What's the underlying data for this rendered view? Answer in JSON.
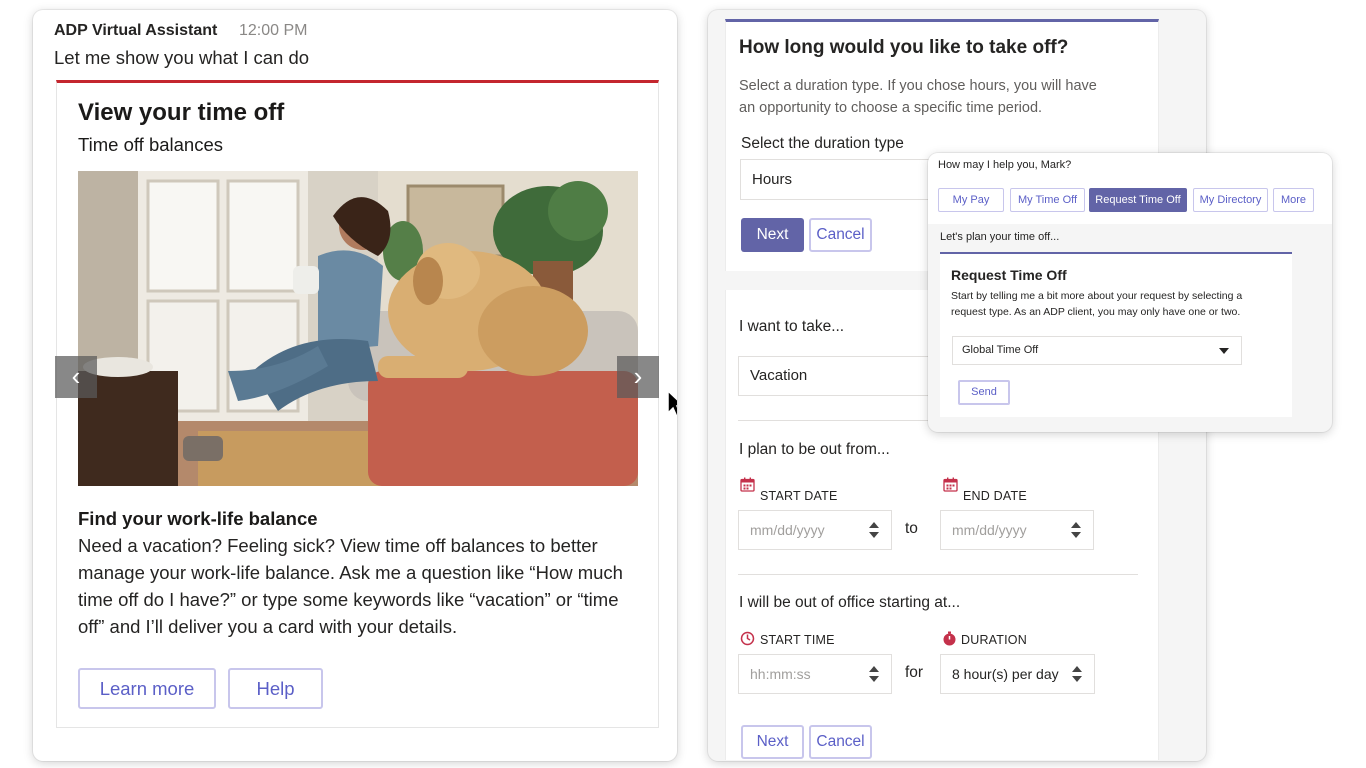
{
  "chat": {
    "sender": "ADP Virtual Assistant",
    "time": "12:00 PM",
    "intro": "Let me show you what I can do"
  },
  "card": {
    "title": "View your time off",
    "subtitle": "Time off balances",
    "heading": "Find your work-life balance",
    "body": "Need a vacation? Feeling sick? View time off balances to better manage your work-life balance. Ask me a question like “How much time off do I have?” or type some keywords like “vacation” or “time off” and I’ll deliver you a card with your details.",
    "learn_more": "Learn more",
    "help": "Help",
    "prev_arrow": "‹",
    "next_arrow": "›"
  },
  "duration_form": {
    "title": "How long would you like to take off?",
    "description": "Select a duration type. If you chose hours, you will have an opportunity to choose a specific time period.",
    "select_label": "Select the duration type",
    "selected": "Hours",
    "next": "Next",
    "cancel": "Cancel"
  },
  "details_form": {
    "take_label": "I want to take...",
    "take_value": "Vacation",
    "out_from_label": "I plan to be out from...",
    "start_date_label": "START DATE",
    "end_date_label": "END DATE",
    "date_placeholder": "mm/dd/yyyy",
    "to": "to",
    "office_label": "I will be out of office starting at...",
    "start_time_label": "START TIME",
    "duration_label": "DURATION",
    "time_placeholder": "hh:mm:ss",
    "for": "for",
    "duration_value": "8 hour(s) per day",
    "next": "Next",
    "cancel": "Cancel"
  },
  "popup": {
    "prompt": "How may I help you, Mark?",
    "tabs": [
      "My Pay",
      "My Time Off",
      "Request Time Off",
      "My Directory",
      "More"
    ],
    "subtitle": "Let's plan your time off...",
    "card_title": "Request Time Off",
    "card_desc": "Start by telling me a bit more about your request by selecting a request type. As an ADP client, you may only have one or two.",
    "select_value": "Global Time Off",
    "send": "Send"
  },
  "colors": {
    "accent": "#6264a7",
    "card_top_border": "#c4262e",
    "icon_pink": "#c4314b"
  }
}
